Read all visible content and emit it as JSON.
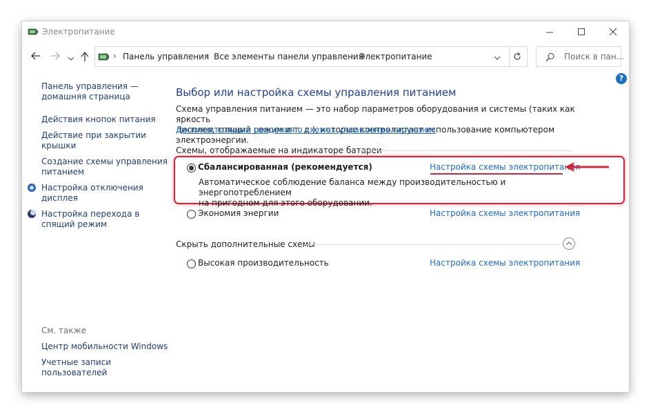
{
  "window": {
    "title": "Электропитание"
  },
  "address": {
    "crumbs": [
      "Панель управления",
      "Все элементы панели управления",
      "Электропитание"
    ],
    "search_placeholder": "Поиск в пан..."
  },
  "left_nav": {
    "home_line1": "Панель управления —",
    "home_line2": "домашняя страница",
    "power_buttons": "Действия кнопок питания",
    "lid_line1": "Действие при закрытии",
    "lid_line2": "крышки",
    "create_line1": "Создание схемы управления",
    "create_line2": "питанием",
    "display_line1": "Настройка отключения",
    "display_line2": "дисплея",
    "sleep_line1": "Настройка перехода в",
    "sleep_line2": "спящий режим",
    "see_also": "См. также",
    "mobility": "Центр мобильности Windows",
    "accounts_line1": "Учетные записи",
    "accounts_line2": "пользователей"
  },
  "main": {
    "heading": "Выбор или настройка схемы управления питанием",
    "desc_line1": "Схема управления питанием — это набор параметров оборудования и системы (таких как яркость",
    "desc_line2": "дисплея, спящий режим и т. д.), которые контролируют использование компьютером электроэнергии.",
    "more_link": "Дополнительные сведения о схемах управления питанием",
    "battery_section": "Схемы, отображаемые на индикаторе батареи",
    "hidden_section": "Скрыть дополнительные схемы",
    "plans": [
      {
        "name": "Сбалансированная (рекомендуется)",
        "selected": true,
        "link": "Настройка схемы электропитания",
        "desc_line1": "Автоматическое соблюдение баланса между производительностью и энергопотреблением",
        "desc_line2": "на пригодном для этого оборудовании."
      },
      {
        "name": "Экономия энергии",
        "selected": false,
        "link": "Настройка схемы электропитания"
      },
      {
        "name": "Высокая производительность",
        "selected": false,
        "link": "Настройка схемы электропитания"
      }
    ]
  },
  "colors": {
    "heading": "#1c3f8f",
    "link": "#1b6ac9",
    "annotation_red": "#d2253a",
    "help": "#1c6fc1"
  }
}
